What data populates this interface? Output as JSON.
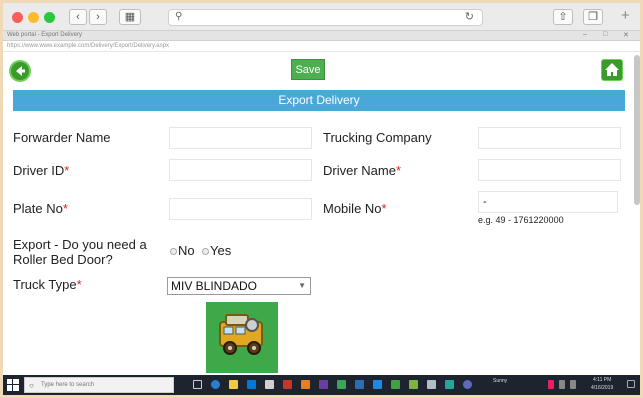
{
  "browser": {
    "tab_title": "Web portal - Export Delivery",
    "address_line": "https://www.www.example.com/Delivery/Export/Delivery.aspx"
  },
  "page": {
    "save_label": "Save",
    "banner_title": "Export Delivery",
    "forwarder_label": "Forwarder Name",
    "trucking_label": "Trucking Company",
    "driver_id_label": "Driver ID",
    "driver_name_label": "Driver Name",
    "plate_label": "Plate No",
    "mobile_label": "Mobile No",
    "mobile_value": "-",
    "mobile_hint": "e.g. 49 - 1761220000",
    "export_label_1": "Export - Do you need a",
    "export_label_2": "Roller Bed Door?",
    "radio_no": "No",
    "radio_yes": "Yes",
    "truck_type_label": "Truck Type",
    "truck_type_value": "MIV BLINDADO",
    "required_mark": "*"
  },
  "taskbar": {
    "search_placeholder": "Type here to search",
    "weather": "Sunny",
    "time": "4:11 PM",
    "date": "4/16/2019"
  },
  "colors": {
    "banner": "#4aa8d8",
    "save": "#4caf50",
    "required": "#e02020",
    "truck_tile": "#3fa849"
  }
}
